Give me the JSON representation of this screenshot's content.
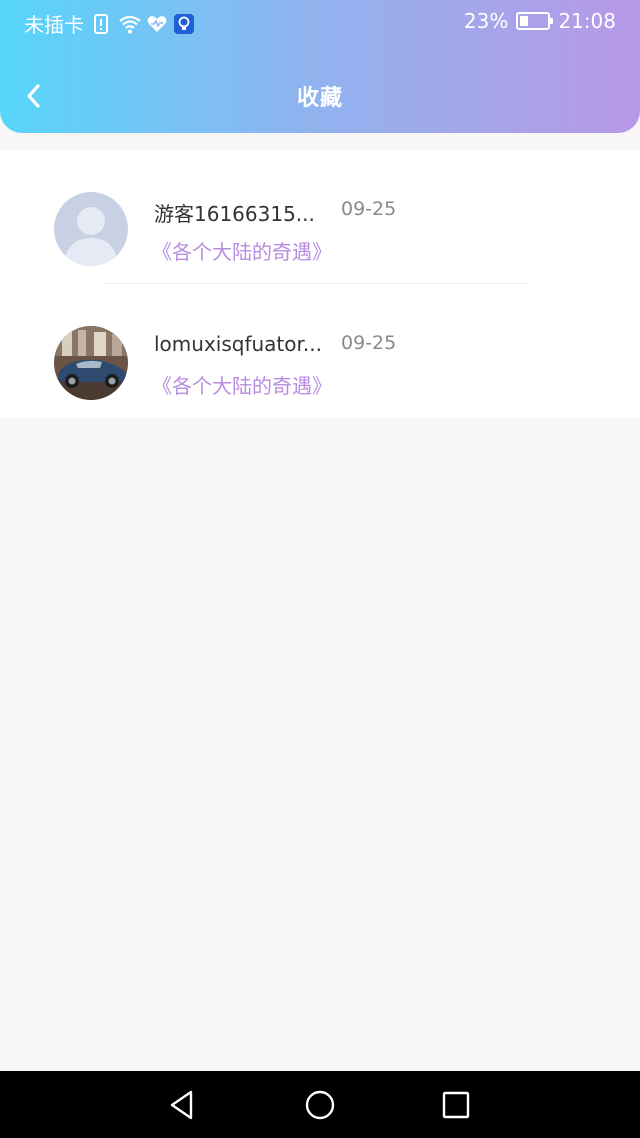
{
  "status": {
    "carrier": "未插卡",
    "battery": "23%",
    "time": "21:08"
  },
  "nav": {
    "title": "收藏"
  },
  "items": [
    {
      "username": "游客16166315...",
      "date": "09-25",
      "book": "《各个大陆的奇遇》"
    },
    {
      "username": "lomuxisqfuator...",
      "date": "09-25",
      "book": "《各个大陆的奇遇》"
    }
  ],
  "colors": {
    "gradient_start": "#56d6fb",
    "gradient_end": "#b898e7",
    "book_link": "#b88de0"
  }
}
